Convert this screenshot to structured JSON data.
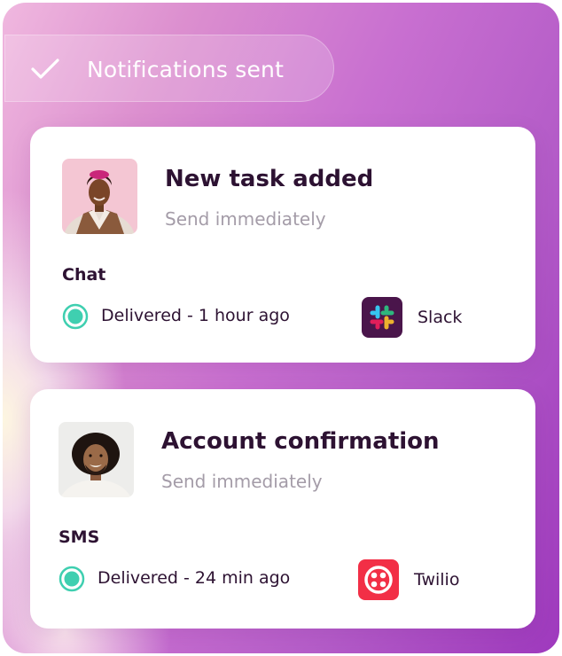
{
  "header": {
    "label": "Notifications sent",
    "icon": "check-icon"
  },
  "notifications": [
    {
      "title": "New task added",
      "subtitle": "Send immediately",
      "channel": "Chat",
      "status": "Delivered - 1 hour ago",
      "status_color": "#3fcfb0",
      "service": "Slack",
      "service_icon": "slack-icon",
      "service_color": "#4a154b"
    },
    {
      "title": "Account confirmation",
      "subtitle": "Send immediately",
      "channel": "SMS",
      "status": "Delivered - 24 min ago",
      "status_color": "#3fcfb0",
      "service": "Twilio",
      "service_icon": "twilio-icon",
      "service_color": "#f22f46"
    }
  ]
}
